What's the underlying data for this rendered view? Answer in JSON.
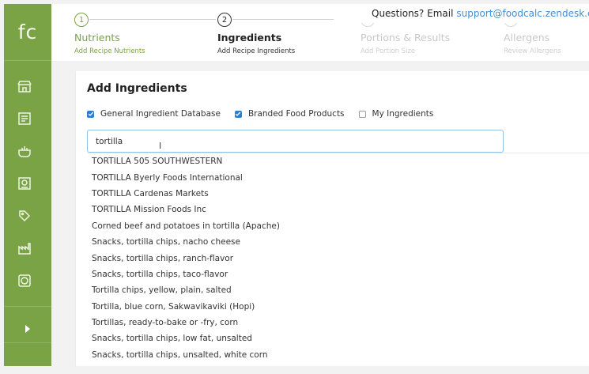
{
  "logo": "fc",
  "sidebar": {
    "icons": [
      "store-icon",
      "recipes-icon",
      "ingredients-icon",
      "labels-icon",
      "tags-icon",
      "factory-icon",
      "support-icon"
    ],
    "expand_icon": "chevron-right-icon"
  },
  "steps": [
    {
      "number": "1",
      "title": "Nutrients",
      "subtitle": "Add Recipe Nutrients",
      "state": "done"
    },
    {
      "number": "2",
      "title": "Ingredients",
      "subtitle": "Add Recipe Ingredients",
      "state": "active"
    },
    {
      "number": "3",
      "title": "Portions & Results",
      "subtitle": "Add Portion Size",
      "state": "pending"
    },
    {
      "number": "4",
      "title": "Allergens",
      "subtitle": "Review Allergens",
      "state": "pending"
    }
  ],
  "help": {
    "text": "Questions? Email",
    "email": "support@foodcalc.zendesk.com"
  },
  "card": {
    "title": "Add Ingredients",
    "filters": [
      {
        "label": "General Ingredient Database",
        "checked": true
      },
      {
        "label": "Branded Food Products",
        "checked": true
      },
      {
        "label": "My Ingredients",
        "checked": false
      }
    ],
    "search_value": "tortilla",
    "results": [
      "TORTILLA 505 SOUTHWESTERN",
      "TORTILLA Byerly Foods International",
      "TORTILLA Cardenas Markets",
      "TORTILLA Mission Foods Inc",
      "Corned beef and potatoes in tortilla (Apache)",
      "Snacks, tortilla chips, nacho cheese",
      "Snacks, tortilla chips, ranch-flavor",
      "Snacks, tortilla chips, taco-flavor",
      "Tortilla chips, yellow, plain, salted",
      "Tortilla, blue corn, Sakwavikaviki (Hopi)",
      "Tortillas, ready-to-bake or -fry, corn",
      "Snacks, tortilla chips, low fat, unsalted",
      "Snacks, tortilla chips, unsalted, white corn"
    ]
  },
  "colors": {
    "brand_green": "#7aa346",
    "accent_blue": "#2d7dd2",
    "link_blue": "#3f8fd8"
  }
}
